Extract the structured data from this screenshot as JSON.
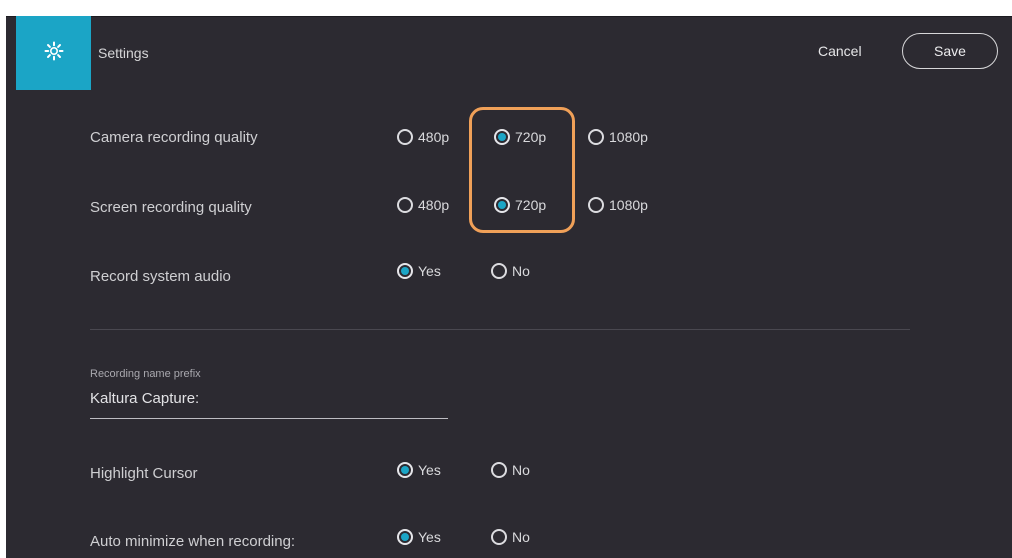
{
  "header": {
    "title": "Settings",
    "icon": "gear-icon",
    "cancel_label": "Cancel",
    "save_label": "Save"
  },
  "settings": {
    "camera_quality": {
      "label": "Camera recording quality",
      "options": [
        "480p",
        "720p",
        "1080p"
      ],
      "selected": "720p"
    },
    "screen_quality": {
      "label": "Screen recording quality",
      "options": [
        "480p",
        "720p",
        "1080p"
      ],
      "selected": "720p"
    },
    "system_audio": {
      "label": "Record system audio",
      "options": [
        "Yes",
        "No"
      ],
      "selected": "Yes"
    },
    "name_prefix": {
      "label": "Recording name prefix",
      "value": "Kaltura Capture:"
    },
    "highlight_cursor": {
      "label": "Highlight Cursor",
      "options": [
        "Yes",
        "No"
      ],
      "selected": "Yes"
    },
    "auto_minimize": {
      "label": "Auto minimize when recording:",
      "options": [
        "Yes",
        "No"
      ],
      "selected": "Yes"
    }
  },
  "colors": {
    "accent": "#1ba5c6",
    "background": "#2c2a31",
    "highlight": "#f0a058"
  }
}
